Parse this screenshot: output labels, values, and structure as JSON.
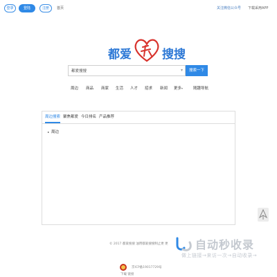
{
  "topbar": {
    "login_label": "登录",
    "account_label": "登陆",
    "register_label": "注册",
    "home_label": "首页",
    "follow_wechat": "关注微信公众号",
    "download_app": "下载采用APP"
  },
  "logo": {
    "text_left": "都爱",
    "text_right": "搜搜"
  },
  "search": {
    "value": "都爱搜搜",
    "button_label": "搜索一下"
  },
  "categories": [
    {
      "label": "周边"
    },
    {
      "label": "商品"
    },
    {
      "label": "商家"
    },
    {
      "label": "生活"
    },
    {
      "label": "人才"
    },
    {
      "label": "招求"
    },
    {
      "label": "新闻"
    },
    {
      "label": "更多"
    },
    {
      "label": "随趣导航"
    }
  ],
  "panel": {
    "tabs": [
      {
        "label": "周边搜索"
      },
      {
        "label": "聚焦都爱"
      },
      {
        "label": "今日排名"
      },
      {
        "label": "产品推荐"
      }
    ],
    "result_label": "周边"
  },
  "footer": {
    "copyright": "© 2017 都爱搜搜 油用都爱搜搜制止更 更",
    "icp": "京ICP备19017729号",
    "icp_sub": "下载 链接"
  },
  "watermark": {
    "title": "自动秒收录",
    "subtitle": "做上链接→来访一次→自动收录→"
  },
  "colors": {
    "accent": "#2f89e6",
    "logo_blue": "#2e79d6",
    "logo_red": "#d8322c"
  }
}
